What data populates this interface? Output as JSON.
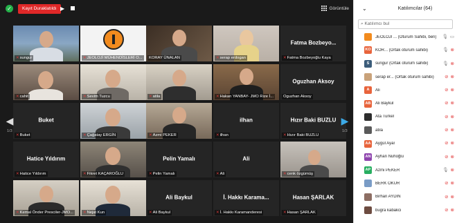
{
  "toolbar": {
    "recording_label": "Kayıt Duraklatıldı",
    "view_label": "Görüntüle"
  },
  "nav": {
    "page_left": "1/3",
    "page_right": "1/3"
  },
  "tiles": [
    {
      "label": "sungur"
    },
    {
      "label": "JEOLOJİ MÜHENDİSLERİ O..."
    },
    {
      "label": "KORAY ÜNALAN"
    },
    {
      "label": "serap erdogan"
    },
    {
      "name": "Fatma Bozbeyo...",
      "label": "Fatma Bozbeyoğlu Kaya"
    },
    {
      "label": "cahit"
    },
    {
      "label": "Sevim Tuzcu"
    },
    {
      "label": "atila"
    },
    {
      "label": "Hakan YANBAY- JMO Rize İ..."
    },
    {
      "name": "Oguzhan Aksoy",
      "label": "Oguzhan Aksoy"
    },
    {
      "name": "Buket",
      "label": "Buket"
    },
    {
      "label": "Çağatay ERGİN"
    },
    {
      "label": "Azmi PEKER"
    },
    {
      "name": "ilhan",
      "label": "ilhan"
    },
    {
      "name": "Hızır Baki BUZLU",
      "label": "Hızır Baki BUZLU"
    },
    {
      "name": "Hatice Yıldırım",
      "label": "Hatice Yıldırım"
    },
    {
      "label": "Fikret KAÇAROĞLU"
    },
    {
      "name": "Pelin Yamalı",
      "label": "Pelin Yamalı"
    },
    {
      "name": "Ali",
      "label": "Ali"
    },
    {
      "label": "cenk özgümüş"
    },
    {
      "label": "Kemal Önder Presciler-JMO..."
    },
    {
      "label": "Nejat Kun"
    },
    {
      "name": "Ali Baykul",
      "label": "Ali Baykul"
    },
    {
      "name": "İ. Hakkı Karama...",
      "label": "İ. Hakkı Karamanderesi"
    },
    {
      "name": "Hasan ŞARLAK",
      "label": "Hasan ŞARLAK"
    }
  ],
  "panel": {
    "title": "Katılımcılar (64)",
    "search_placeholder": "Katılımcı bul",
    "participants": [
      {
        "initials": "",
        "name": "JEOLOJİ ...   (Oturum Sahibi, ben)",
        "color": "#f28b1e",
        "mic": "ok",
        "cam": "ok"
      },
      {
        "initials": "KO",
        "name": "KOR...  (Ortak oturum sahibi)",
        "color": "#e8643c",
        "mic": "ok",
        "cam": "off"
      },
      {
        "initials": "S",
        "name": "sungur  (Ortak oturum sahibi)",
        "color": "#3b5c7a",
        "mic": "ok",
        "cam": "off"
      },
      {
        "initials": "",
        "name": "serap er...  (Ortak oturum sahibi)",
        "color": "#c9a27a",
        "mic": "off",
        "cam": "off"
      },
      {
        "initials": "A",
        "name": "Ali",
        "color": "#e8643c",
        "mic": "off",
        "cam": "off"
      },
      {
        "initials": "AB",
        "name": "Ali Baykul",
        "color": "#e8643c",
        "mic": "off",
        "cam": "off"
      },
      {
        "initials": "",
        "name": "Ata Turkel",
        "color": "#2d2d2d",
        "mic": "off",
        "cam": "off"
      },
      {
        "initials": "",
        "name": "atila",
        "color": "#5a5a5a",
        "mic": "off",
        "cam": "off"
      },
      {
        "initials": "AA",
        "name": "Aygül Ayar",
        "color": "#e8643c",
        "mic": "off",
        "cam": "off"
      },
      {
        "initials": "AN",
        "name": "Ayhan Nuhoğlu",
        "color": "#8e44ad",
        "mic": "off",
        "cam": "off"
      },
      {
        "initials": "AP",
        "name": "Azmi PEKER",
        "color": "#27ae60",
        "mic": "ok",
        "cam": "off"
      },
      {
        "initials": "",
        "name": "BERK OKUR",
        "color": "#7a9cc6",
        "mic": "off",
        "cam": "off"
      },
      {
        "initials": "",
        "name": "Birhan AYDIN",
        "color": "#8d6e63",
        "mic": "off",
        "cam": "off"
      },
      {
        "initials": "",
        "name": "bugra kabakci",
        "color": "#6d4c41",
        "mic": "off",
        "cam": "off"
      }
    ]
  }
}
